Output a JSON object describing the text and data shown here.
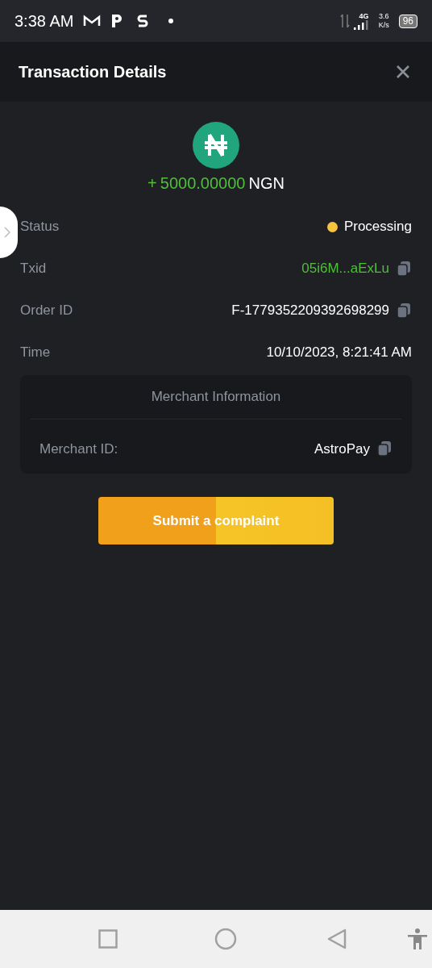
{
  "status_bar": {
    "time": "3:38 AM",
    "network": "4G",
    "speed_value": "3.6",
    "speed_unit": "K/s",
    "battery": "96"
  },
  "header": {
    "title": "Transaction Details"
  },
  "amount": {
    "sign": "+",
    "value": "5000.00000",
    "currency": "NGN"
  },
  "details": [
    {
      "label": "Status",
      "value": "Processing",
      "kind": "status",
      "color": "#f7c23c"
    },
    {
      "label": "Txid",
      "value": "05i6M...aExLu",
      "kind": "link",
      "copy": true
    },
    {
      "label": "Order ID",
      "value": "F-1779352209392698299",
      "kind": "plain",
      "copy": true
    },
    {
      "label": "Time",
      "value": "10/10/2023, 8:21:41 AM",
      "kind": "plain",
      "copy": false
    }
  ],
  "merchant": {
    "title": "Merchant Information",
    "rows": [
      {
        "label": "Merchant ID:",
        "value": "AstroPay",
        "copy": true
      }
    ]
  },
  "button": {
    "label": "Submit a complaint"
  }
}
